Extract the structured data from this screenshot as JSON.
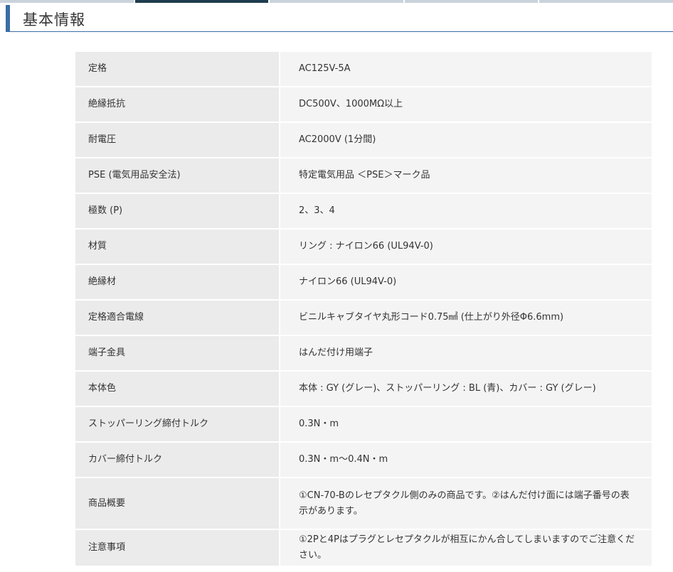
{
  "section": {
    "title": "基本情報"
  },
  "specs": [
    {
      "label": "定格",
      "value": "AC125V-5A"
    },
    {
      "label": "絶縁抵抗",
      "value": "DC500V、1000MΩ以上"
    },
    {
      "label": "耐電圧",
      "value": "AC2000V (1分間)"
    },
    {
      "label": "PSE (電気用品安全法)",
      "value": "特定電気用品 ＜PSE＞マーク品"
    },
    {
      "label": "極数 (P)",
      "value": "2、3、4"
    },
    {
      "label": "材質",
      "value": "リング : ナイロン66 (UL94V-0)"
    },
    {
      "label": "絶縁材",
      "value": "ナイロン66 (UL94V-0)"
    },
    {
      "label": "定格適合電線",
      "value": "ビニルキャブタイヤ丸形コード0.75㎟ (仕上がり外径Φ6.6mm)"
    },
    {
      "label": "端子金具",
      "value": "はんだ付け用端子"
    },
    {
      "label": "本体色",
      "value": "本体 : GY (グレー)、ストッパーリング : BL (青)、カバー : GY (グレー)"
    },
    {
      "label": "ストッパーリング締付トルク",
      "value": "0.3N・m"
    },
    {
      "label": "カバー締付トルク",
      "value": "0.3N・m〜0.4N・m"
    },
    {
      "label": "商品概要",
      "value": "①CN-70-Bのレセプタクル側のみの商品です。②はんだ付け面には端子番号の表示があります。"
    },
    {
      "label": "注意事項",
      "value": "①2Pと4Pはプラグとレセプタクルが相互にかん合してしまいますのでご注意ください。"
    }
  ]
}
